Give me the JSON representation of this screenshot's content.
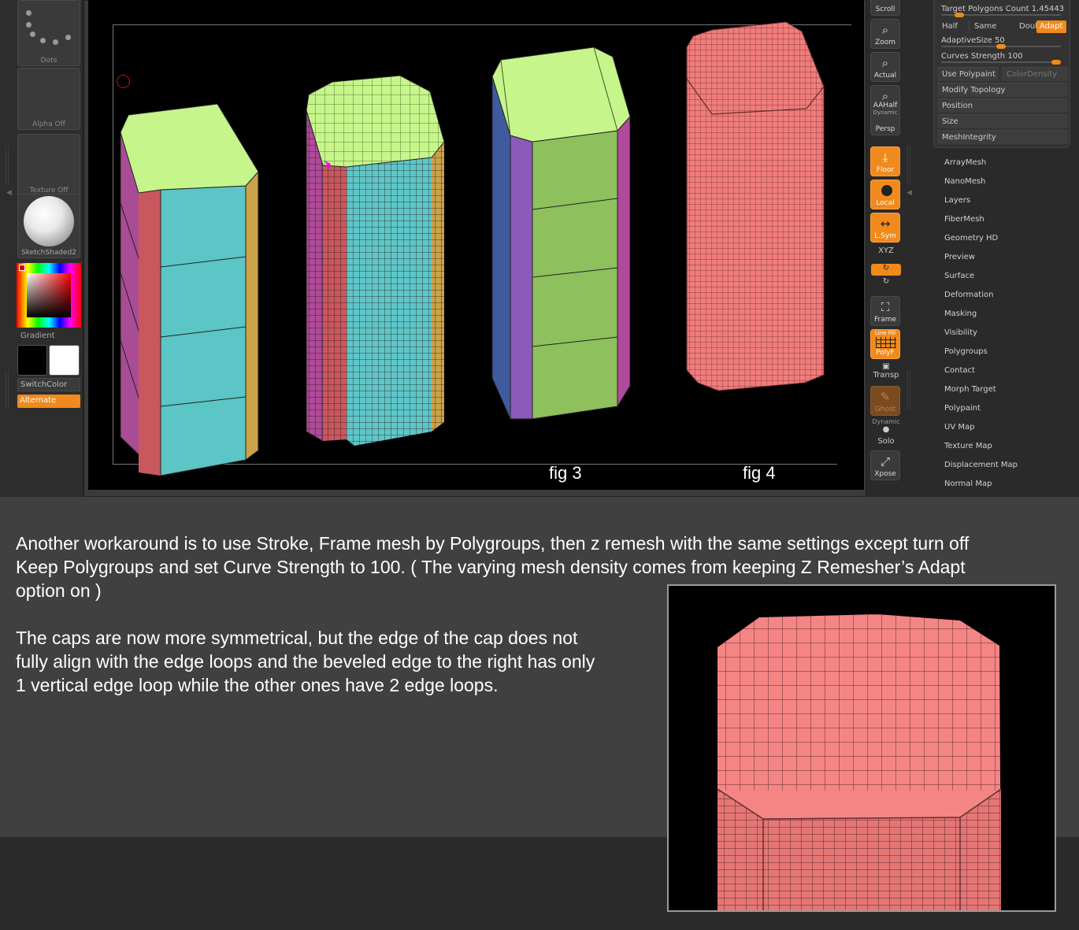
{
  "left_tray": {
    "dots_label": "Dots",
    "alpha_label": "Alpha Off",
    "texture_label": "Texture Off",
    "material_label": "SketchShaded2",
    "gradient_label": "Gradient",
    "switchcolor_label": "SwitchColor",
    "alternate_label": "Alternate"
  },
  "viewport": {
    "fig3_label": "fig 3",
    "fig4_label": "fig 4"
  },
  "shelf": {
    "scroll": "Scroll",
    "zoom": "Zoom",
    "actual": "Actual",
    "aahalf": "AAHalf",
    "dynamic_label": "Dynamic",
    "persp": "Persp",
    "floor": "Floor",
    "local": "Local",
    "lsym": "L.Sym",
    "xyz": "XYZ",
    "frame": "Frame",
    "linefill": "Line Fill",
    "polyf": "PolyF",
    "transp": "Transp",
    "ghost": "Ghost",
    "solo": "Solo",
    "xpose": "Xpose"
  },
  "zremesher": {
    "target_label": "Target Polygons Count",
    "target_value": "1.45443",
    "target_fraction": 0.15,
    "half": "Half",
    "same": "Same",
    "double": "Double",
    "adapt": "Adapt",
    "adaptive_label": "AdaptiveSize",
    "adaptive_value": "50",
    "adaptive_fraction": 0.5,
    "curves_label": "Curves Strength",
    "curves_value": "100",
    "curves_fraction": 1.0,
    "use_polypaint": "Use Polypaint",
    "color_density": "ColorDensity",
    "modify_topology": "Modify Topology",
    "position": "Position",
    "size": "Size",
    "mesh_integrity": "MeshIntegrity"
  },
  "tool_menu": [
    "ArrayMesh",
    "NanoMesh",
    "Layers",
    "FiberMesh",
    "Geometry HD",
    "Preview",
    "Surface",
    "Deformation",
    "Masking",
    "Visibility",
    "Polygroups",
    "Contact",
    "Morph Target",
    "Polypaint",
    "UV Map",
    "Texture Map",
    "Displacement Map",
    "Normal Map"
  ],
  "colors": {
    "accent": "#f08a1c",
    "cap_green": "#c8f58a",
    "cyan": "#5ec6c8",
    "magenta": "#b04a9a",
    "mesh_red": "#f07c7c"
  },
  "article": {
    "para1_line1": "Another workaround is to use Stroke, Frame mesh by Polygroups, then z remesh with the same settings except turn off",
    "para1_line2": "Keep Polygroups and set Curve Strength to 100. ( The varying mesh density comes from keeping Z Remesher’s Adapt",
    "para1_line3": "option on )",
    "para2_line1": "The caps are now more symmetrical, but the edge of the cap does not",
    "para2_line2": "fully align with the edge loops and the beveled edge to the right has only",
    "para2_line3": "1 vertical edge loop while the other ones have 2 edge loops."
  }
}
